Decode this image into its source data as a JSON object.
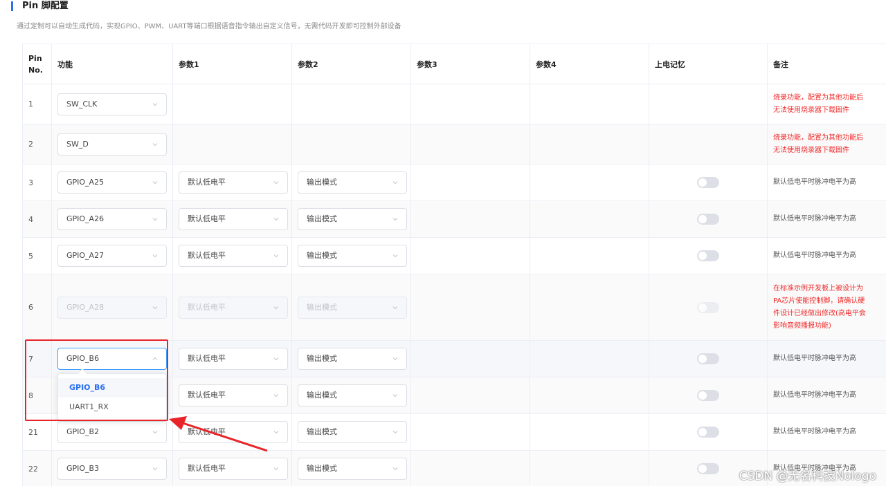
{
  "section": {
    "title": "Pin 脚配置",
    "description": "通过定制可以自动生成代码，实现GPIO、PWM、UART等端口根据语音指令输出自定义信号，无需代码开发即可控制外部设备"
  },
  "table": {
    "headers": [
      "Pin No.",
      "功能",
      "参数1",
      "参数2",
      "参数3",
      "参数4",
      "上电记忆",
      "备注"
    ],
    "rows": [
      {
        "pin": "1",
        "func": "SW_CLK",
        "p1": "",
        "p2": "",
        "note": [
          "烧录功能，配置为其他功能后",
          "无法使用烧录器下载固件"
        ],
        "note_red": true
      },
      {
        "pin": "2",
        "func": "SW_D",
        "p1": "",
        "p2": "",
        "note": [
          "烧录功能，配置为其他功能后",
          "无法使用烧录器下载固件"
        ],
        "note_red": true
      },
      {
        "pin": "3",
        "func": "GPIO_A25",
        "p1": "默认低电平",
        "p2": "输出模式",
        "note": [
          "默认低电平时脉冲电平为高"
        ]
      },
      {
        "pin": "4",
        "func": "GPIO_A26",
        "p1": "默认低电平",
        "p2": "输出模式",
        "note": [
          "默认低电平时脉冲电平为高"
        ]
      },
      {
        "pin": "5",
        "func": "GPIO_A27",
        "p1": "默认低电平",
        "p2": "输出模式",
        "note": [
          "默认低电平时脉冲电平为高"
        ]
      },
      {
        "pin": "6",
        "func": "GPIO_A28",
        "p1": "默认低电平",
        "p2": "输出模式",
        "note": [
          "在标准示例开发板上被设计为",
          "PA芯片使能控制脚，请确认硬",
          "件设计已经做出修改(高电平会",
          "影响音频播报功能)"
        ],
        "note_red": true
      },
      {
        "pin": "7",
        "func": "GPIO_B6",
        "p1": "默认低电平",
        "p2": "输出模式",
        "note": [
          "默认低电平时脉冲电平为高"
        ]
      },
      {
        "pin": "8",
        "func": "",
        "p1": "默认低电平",
        "p2": "输出模式",
        "note": [
          "默认低电平时脉冲电平为高"
        ]
      },
      {
        "pin": "21",
        "func": "GPIO_B2",
        "p1": "默认低电平",
        "p2": "输出模式",
        "note": [
          "默认低电平时脉冲电平为高"
        ]
      },
      {
        "pin": "22",
        "func": "GPIO_B3",
        "p1": "默认低电平",
        "p2": "输出模式",
        "note": [
          "默认低电平时脉冲电平为高"
        ]
      }
    ]
  },
  "dropdown": {
    "options": [
      "GPIO_B6",
      "UART1_RX"
    ],
    "selected": "GPIO_B6"
  },
  "watermark": "CSDN @无名科技Nologo",
  "colors": {
    "accent": "#2a6ff0",
    "warning_text": "#f02a2a",
    "annotation_red": "#e8242a"
  },
  "icons": {
    "select_arrow": "chevron-down-icon",
    "select_arrow_open": "chevron-up-icon"
  }
}
